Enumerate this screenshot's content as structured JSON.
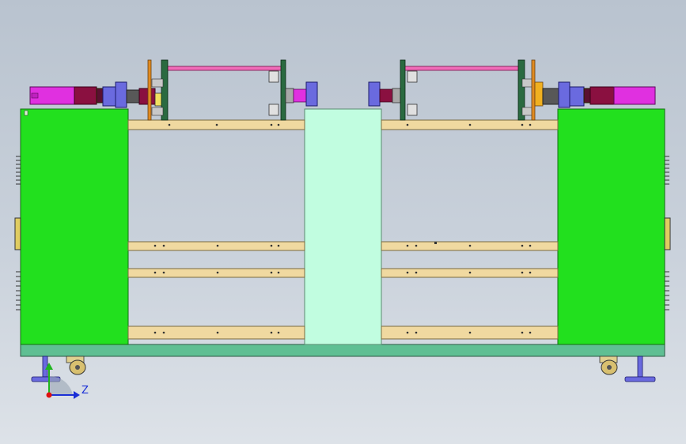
{
  "viewport": {
    "background": "#c6cfd9",
    "colors": {
      "cabinet": "#22e01e",
      "center_panel": "#c1fde0",
      "base": "#5fbf93",
      "rail": "#f0d9a0",
      "motor": "#e030e0",
      "motor_dark": "#8a1040",
      "coupling": "#6a6adf",
      "shaft": "#f06ab8",
      "frame_post": "#e08a20",
      "plate": "#2a6a40"
    }
  },
  "triad": {
    "y_label": "Y",
    "z_label": "Z",
    "y_color": "#1fb51f",
    "z_color": "#1a2fd6",
    "x_color": "#e01010"
  }
}
